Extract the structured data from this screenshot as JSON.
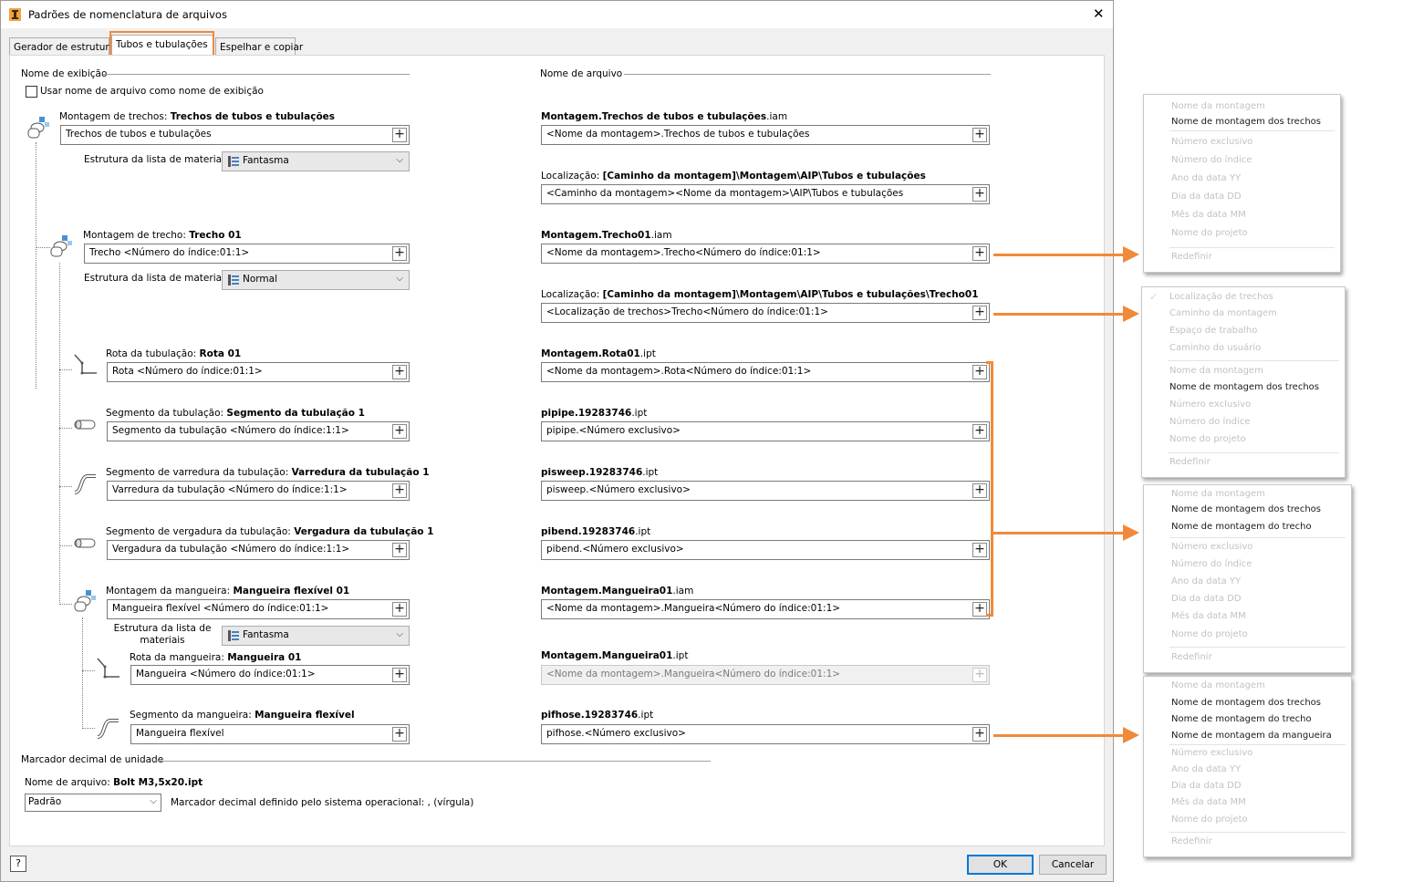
{
  "title": "Padrões de nomenclatura de arquivos",
  "tabs": [
    "Gerador de estrutura",
    "Tubos e tubulações",
    "Espelhar e copiar"
  ],
  "display_section": "Nome de exibição",
  "file_section": "Nome de arquivo",
  "use_filename_checkbox": "Usar nome de arquivo como nome de exibição",
  "bom_label": "Estrutura da lista de materiais",
  "bom_label_split": [
    "Estrutura da lista de",
    "materiais"
  ],
  "rows": [
    {
      "label": "Montagem de trechos: ",
      "label_bold": "Trechos de tubos e tubulações",
      "value": "Trechos de tubos e tubulações",
      "bom": "Fantasma",
      "file_bold": "Montagem.Trechos de tubos e tubulações",
      "file_ext": ".iam",
      "file_value": "<Nome da montagem>.Trechos de tubos e tubulações",
      "loc_label": "Localização: ",
      "loc_bold": "[Caminho da montagem]\\Montagem\\AIP\\Tubos e tubulações",
      "loc_value": "<Caminho da montagem><Nome da montagem>\\AIP\\Tubos e tubulações"
    },
    {
      "label": "Montagem de trecho: ",
      "label_bold": "Trecho 01",
      "value": "Trecho <Número do índice:01:1>",
      "bom": "Normal",
      "file_bold": "Montagem.Trecho01",
      "file_ext": ".iam",
      "file_value": "<Nome da montagem>.Trecho<Número do índice:01:1>",
      "loc_label": "Localização: ",
      "loc_bold": "[Caminho da montagem]\\Montagem\\AIP\\Tubos e tubulações\\Trecho01",
      "loc_value": "<Localização de trechos>Trecho<Número do índice:01:1>"
    },
    {
      "label": "Rota da tubulação: ",
      "label_bold": "Rota 01",
      "value": "Rota <Número do índice:01:1>",
      "file_bold": "Montagem.Rota01",
      "file_ext": ".ipt",
      "file_value": "<Nome da montagem>.Rota<Número do índice:01:1>"
    },
    {
      "label": "Segmento da tubulação: ",
      "label_bold": "Segmento da tubulação 1",
      "value": "Segmento da tubulação <Número do índice:1:1>",
      "file_bold": "pipipe.19283746",
      "file_ext": ".ipt",
      "file_value": "pipipe.<Número exclusivo>"
    },
    {
      "label": "Segmento de varredura da tubulação: ",
      "label_bold": "Varredura da tubulação 1",
      "value": "Varredura da tubulação <Número do índice:1:1>",
      "file_bold": "pisweep.19283746",
      "file_ext": ".ipt",
      "file_value": "pisweep.<Número exclusivo>"
    },
    {
      "label": "Segmento de vergadura da tubulação: ",
      "label_bold": "Vergadura da tubulação 1",
      "value": "Vergadura da tubulação <Número do índice:1:1>",
      "file_bold": "pibend.19283746",
      "file_ext": ".ipt",
      "file_value": "pibend.<Número exclusivo>"
    },
    {
      "label": "Montagem da mangueira: ",
      "label_bold": "Mangueira flexível 01",
      "value": "Mangueira flexível <Número do índice:01:1>",
      "bom": "Fantasma",
      "file_bold": "Montagem.Mangueira01",
      "file_ext": ".iam",
      "file_value": "<Nome da montagem>.Mangueira<Número do índice:01:1>"
    },
    {
      "label": "Rota da mangueira: ",
      "label_bold": "Mangueira 01",
      "value": "Mangueira <Número do índice:01:1>",
      "file_bold": "Montagem.Mangueira01",
      "file_ext": ".ipt",
      "file_value": "<Nome da montagem>.Mangueira<Número do índice:01:1>"
    },
    {
      "label": "Segmento da mangueira: ",
      "label_bold": "Mangueira flexível",
      "value": "Mangueira flexível",
      "file_bold": "pifhose.19283746",
      "file_ext": ".ipt",
      "file_value": "pifhose.<Número exclusivo>"
    }
  ],
  "decimal_section": "Marcador decimal de unidade",
  "decimal_filename_label": "Nome de arquivo: ",
  "decimal_filename": "Bolt M3,5x20.ipt",
  "decimal_select": "Padrão",
  "decimal_note": "Marcador decimal definido pelo sistema operacional: , (vírgula)",
  "ok": "OK",
  "cancel": "Cancelar",
  "close": "✕",
  "help": "?",
  "menus": [
    {
      "items": [
        [
          "Nome da montagem",
          0
        ],
        [
          "Nome de montagem dos trechos",
          1
        ],
        [
          "Número exclusivo",
          0
        ],
        [
          "Número do índice",
          0
        ],
        [
          "Ano da data YY",
          0
        ],
        [
          "Dia da data DD",
          0
        ],
        [
          "Mês da data MM",
          0
        ],
        [
          "Nome do projeto",
          0
        ],
        [
          "Redefinir",
          0
        ]
      ]
    },
    {
      "items": [
        [
          "Localização de trechos",
          0
        ],
        [
          "Caminho da montagem",
          0
        ],
        [
          "Espaço de trabalho",
          0
        ],
        [
          "Caminho do usuário",
          0
        ],
        [
          "Nome da montagem",
          0
        ],
        [
          "Nome de montagem dos trechos",
          1
        ],
        [
          "Número exclusivo",
          0
        ],
        [
          "Número do índice",
          0
        ],
        [
          "Nome do projeto",
          0
        ],
        [
          "Redefinir",
          0
        ]
      ]
    },
    {
      "items": [
        [
          "Nome da montagem",
          0
        ],
        [
          "Nome de montagem dos trechos",
          1
        ],
        [
          "Nome de montagem do trecho",
          1
        ],
        [
          "Número exclusivo",
          0
        ],
        [
          "Número do índice",
          0
        ],
        [
          "Ano da data YY",
          0
        ],
        [
          "Dia da data DD",
          0
        ],
        [
          "Mês da data MM",
          0
        ],
        [
          "Nome do projeto",
          0
        ],
        [
          "Redefinir",
          0
        ]
      ]
    },
    {
      "items": [
        [
          "Nome da montagem",
          0
        ],
        [
          "Nome de montagem dos trechos",
          1
        ],
        [
          "Nome de montagem do trecho",
          1
        ],
        [
          "Nome de montagem da mangueira",
          1
        ],
        [
          "Número exclusivo",
          0
        ],
        [
          "Ano da data YY",
          0
        ],
        [
          "Dia da data DD",
          0
        ],
        [
          "Mês da data MM",
          0
        ],
        [
          "Nome do projeto",
          0
        ],
        [
          "Redefinir",
          0
        ]
      ]
    }
  ],
  "accent_color": "#f08a3a"
}
